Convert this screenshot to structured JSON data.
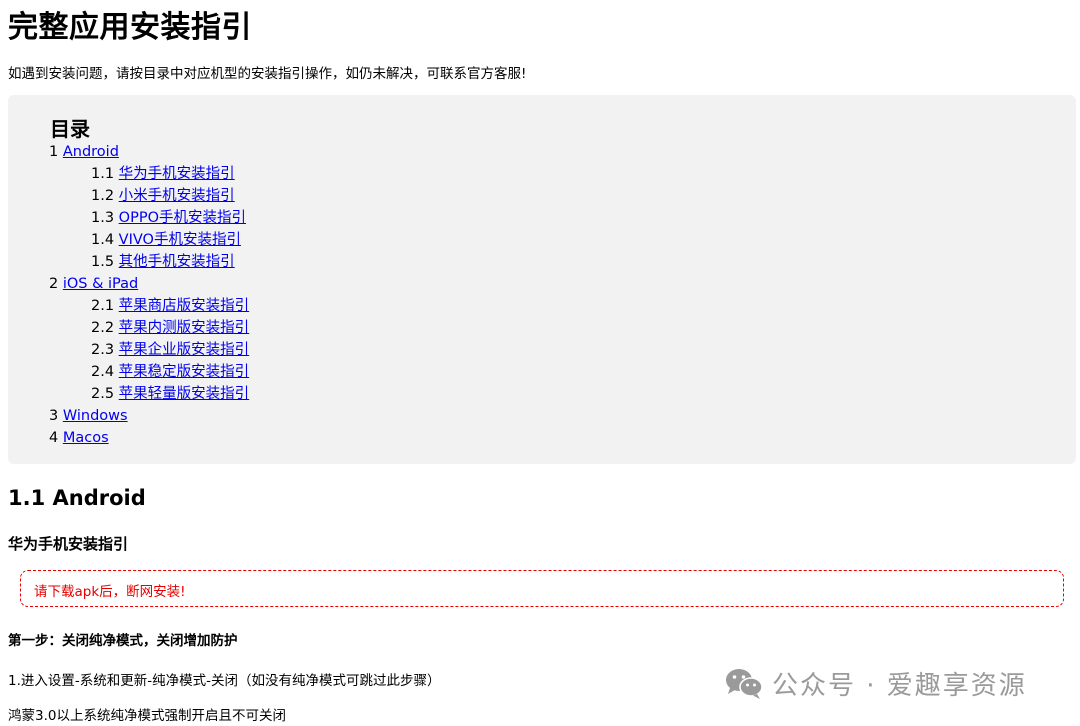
{
  "title": "完整应用安装指引",
  "intro": "如遇到安装问题，请按目录中对应机型的安装指引操作，如仍未解决，可联系官方客服!",
  "toc": {
    "heading": "目录",
    "items": [
      {
        "num": "1",
        "label": "Android",
        "level": 1
      },
      {
        "num": "1.1",
        "label": "华为手机安装指引",
        "level": 2
      },
      {
        "num": "1.2",
        "label": "小米手机安装指引",
        "level": 2
      },
      {
        "num": "1.3",
        "label": "OPPO手机安装指引",
        "level": 2
      },
      {
        "num": "1.4",
        "label": "VIVO手机安装指引",
        "level": 2
      },
      {
        "num": "1.5",
        "label": "其他手机安装指引",
        "level": 2
      },
      {
        "num": "2",
        "label": "iOS & iPad",
        "level": 1
      },
      {
        "num": "2.1",
        "label": "苹果商店版安装指引",
        "level": 2
      },
      {
        "num": "2.2",
        "label": "苹果内测版安装指引",
        "level": 2
      },
      {
        "num": "2.3",
        "label": "苹果企业版安装指引",
        "level": 2
      },
      {
        "num": "2.4",
        "label": "苹果稳定版安装指引",
        "level": 2
      },
      {
        "num": "2.5",
        "label": "苹果轻量版安装指引",
        "level": 2
      },
      {
        "num": "3",
        "label": "Windows",
        "level": 1
      },
      {
        "num": "4",
        "label": "Macos",
        "level": 1
      }
    ]
  },
  "section": {
    "heading": "1.1 Android",
    "subheading": "华为手机安装指引",
    "warning": "请下载apk后，断网安装!",
    "step_title": "第一步：关闭纯净模式，关闭增加防护",
    "step_line1": "1.进入设置-系统和更新-纯净模式-关闭（如没有纯净模式可跳过此步骤）",
    "step_line2": "鸿蒙3.0以上系统纯净模式强制开启且不可关闭"
  },
  "watermark": {
    "text": "公众号 · 爱趣享资源",
    "icon": "wechat-icon"
  },
  "colors": {
    "link": "#0000ee",
    "warning": "#e60000",
    "toc_background": "#f2f2f2",
    "watermark": "#9a9a9a"
  }
}
